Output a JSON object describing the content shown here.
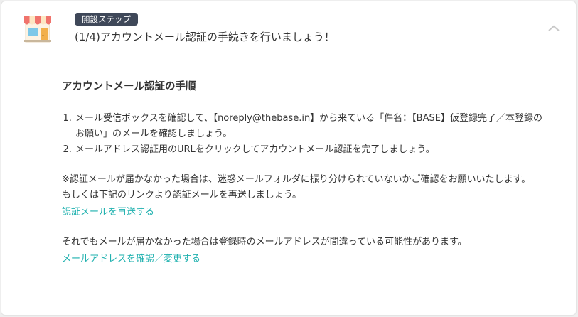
{
  "header": {
    "badge": "開設ステップ",
    "title": "(1/4)アカウントメール認証の手続きを行いましょう！"
  },
  "icons": {
    "shop": "shop-storefront-icon",
    "collapse": "chevron-up-icon"
  },
  "colors": {
    "badge_bg": "#3f4859",
    "link": "#1db0ae",
    "awning_red": "#f0736c",
    "awning_cream": "#fde7c3",
    "window_blue": "#7dc8e8",
    "door_orange": "#f2b04a"
  },
  "content": {
    "section_title": "アカウントメール認証の手順",
    "steps": [
      "メール受信ボックスを確認して、【noreply@thebase.in】から来ている「件名：【BASE】仮登録完了／本登録のお願い」のメールを確認しましょう。",
      "メールアドレス認証用のURLをクリックしてアカウントメール認証を完了しましょう。"
    ],
    "note_line1": "※認証メールが届かなかった場合は、迷惑メールフォルダに振り分けられていないかご確認をお願いいたします。",
    "note_line2": "もしくは下記のリンクより認証メールを再送しましょう。",
    "resend_link": "認証メールを再送する",
    "note_line3": "それでもメールが届かなかった場合は登録時のメールアドレスが間違っている可能性があります。",
    "change_link": "メールアドレスを確認／変更する"
  }
}
